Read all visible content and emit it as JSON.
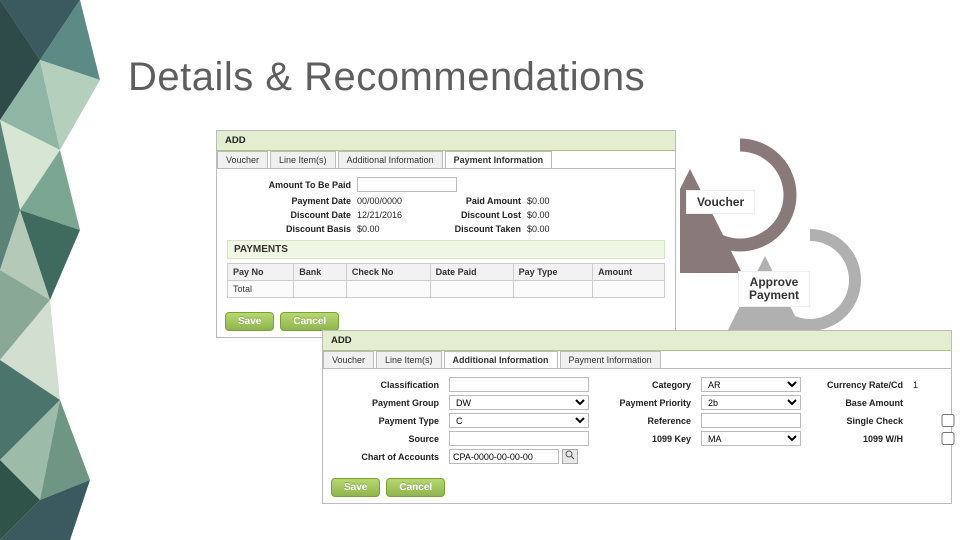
{
  "page": {
    "title": "Details & Recommendations"
  },
  "cycle": {
    "voucher": "Voucher",
    "approve_line1": "Approve",
    "approve_line2": "Payment"
  },
  "card1": {
    "add": "ADD",
    "tabs": [
      "Voucher",
      "Line Item(s)",
      "Additional Information",
      "Payment Information"
    ],
    "active_tab": 3,
    "amount_label": "Amount To Be Paid",
    "payment_date_label": "Payment Date",
    "payment_date_value": "00/00/0000",
    "paid_amount_label": "Paid Amount",
    "paid_amount_value": "$0.00",
    "discount_date_label": "Discount Date",
    "discount_date_value": "12/21/2016",
    "discount_lost_label": "Discount Lost",
    "discount_lost_value": "$0.00",
    "discount_basis_label": "Discount Basis",
    "discount_basis_value": "$0.00",
    "discount_taken_label": "Discount Taken",
    "discount_taken_value": "$0.00",
    "payments_hdr": "PAYMENTS",
    "cols": [
      "Pay No",
      "Bank",
      "Check No",
      "Date Paid",
      "Pay Type",
      "Amount"
    ],
    "total_label": "Total",
    "save": "Save",
    "cancel": "Cancel"
  },
  "card2": {
    "add": "ADD",
    "tabs": [
      "Voucher",
      "Line Item(s)",
      "Additional Information",
      "Payment Information"
    ],
    "active_tab": 2,
    "classification_label": "Classification",
    "payment_group_label": "Payment Group",
    "payment_group_value": "DW",
    "payment_type_label": "Payment Type",
    "payment_type_value": "C",
    "category_label": "Category",
    "category_value": "AR",
    "payment_priority_label": "Payment Priority",
    "payment_priority_value": "2b",
    "reference_label": "Reference",
    "source_label": "Source",
    "key1099_label": "1099 Key",
    "key1099_value": "MA",
    "coa_label": "Chart of Accounts",
    "coa_value": "CPA-0000-00-00-00",
    "currency_rate_label": "Currency Rate/Cd",
    "currency_rate_value": "1",
    "base_amount_label": "Base Amount",
    "single_check_label": "Single Check",
    "wh1099_label": "1099 W/H",
    "save": "Save",
    "cancel": "Cancel"
  }
}
